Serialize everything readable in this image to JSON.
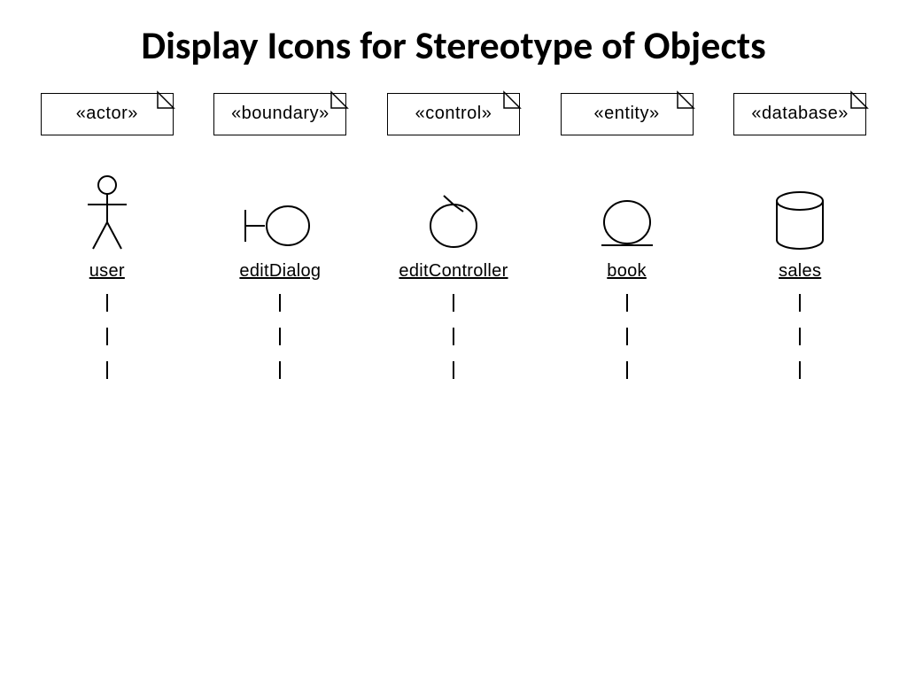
{
  "title": "Display Icons for Stereotype of Objects",
  "items": [
    {
      "stereotype": "«actor»",
      "name": "user",
      "icon": "actor"
    },
    {
      "stereotype": "«boundary»",
      "name": "editDialog",
      "icon": "boundary"
    },
    {
      "stereotype": "«control»",
      "name": "editController",
      "icon": "control"
    },
    {
      "stereotype": "«entity»",
      "name": "book",
      "icon": "entity"
    },
    {
      "stereotype": "«database»",
      "name": "sales",
      "icon": "database"
    }
  ]
}
